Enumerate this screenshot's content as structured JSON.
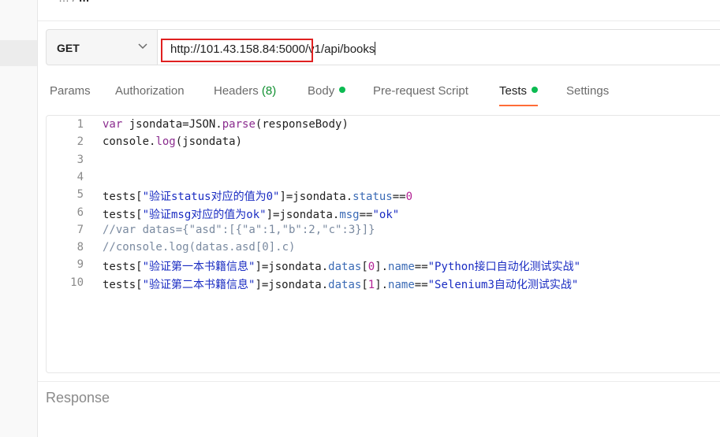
{
  "breadcrumb": {
    "parent": "…",
    "current": "…"
  },
  "request": {
    "method": "GET",
    "url": "http://101.43.158.84:5000/v1/api/books"
  },
  "tabs": [
    {
      "label": "Params"
    },
    {
      "label": "Authorization"
    },
    {
      "label": "Headers",
      "count": "(8)"
    },
    {
      "label": "Body",
      "dot": true
    },
    {
      "label": "Pre-request Script"
    },
    {
      "label": "Tests",
      "dot": true,
      "active": true
    },
    {
      "label": "Settings"
    }
  ],
  "editor": {
    "lines": [
      {
        "n": "1",
        "text": "var jsondata=JSON.parse(responseBody)"
      },
      {
        "n": "2",
        "text": "console.log(jsondata)"
      },
      {
        "n": "3",
        "text": ""
      },
      {
        "n": "4",
        "text": ""
      },
      {
        "n": "5",
        "text": "tests[\"验证status对应的值为0\"]=jsondata.status==0"
      },
      {
        "n": "6",
        "text": "tests[\"验证msg对应的值为ok\"]=jsondata.msg==\"ok\""
      },
      {
        "n": "7",
        "text": "//var datas={\"asd\":[{\"a\":1,\"b\":2,\"c\":3}]}"
      },
      {
        "n": "8",
        "text": "//console.log(datas.asd[0].c)"
      },
      {
        "n": "9",
        "text": "tests[\"验证第一本书籍信息\"]=jsondata.datas[0].name==\"Python接口自动化测试实战\""
      },
      {
        "n": "10",
        "text": "tests[\"验证第二本书籍信息\"]=jsondata.datas[1].name==\"Selenium3自动化测试实战\""
      }
    ]
  },
  "response": {
    "label": "Response"
  },
  "colors": {
    "accent": "#ff6c37",
    "dot": "#0cbb52",
    "highlight": "#e02020"
  }
}
